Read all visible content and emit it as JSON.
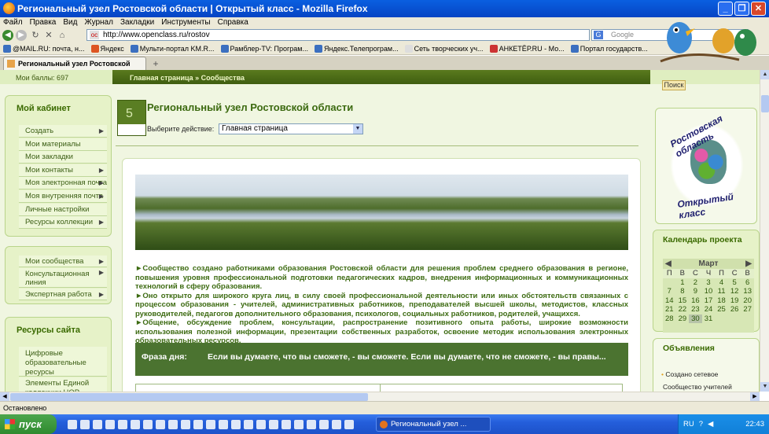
{
  "window": {
    "title": "Региональный узел Ростовской области | Открытый класс - Mozilla Firefox",
    "min": "_",
    "max": "❐",
    "close": "✕"
  },
  "menubar": [
    "Файл",
    "Правка",
    "Вид",
    "Журнал",
    "Закладки",
    "Инструменты",
    "Справка"
  ],
  "nav": {
    "url": "http://www.openclass.ru/rostov",
    "search_placeholder": "Google"
  },
  "bookmarks": [
    "@MAIL.RU: почта, н...",
    "Яндекс",
    "Мульти-портал KM.R...",
    "Рамблер-TV: Програм...",
    "Яндекс.Телепрограм...",
    "Сеть творческих уч...",
    "АНКЕТЁР.RU - Мо...",
    "Портал государств..."
  ],
  "tab": {
    "title": "Региональный узел Ростовской обл...",
    "plus": "+"
  },
  "site": {
    "points": "Мои баллы: 697",
    "breadcrumb": "Главная страница   »   Сообщества",
    "badge": "5",
    "page_title": "Региональный узел Ростовской области",
    "action_label": "Выберите действие:",
    "action_value": "Главная страница"
  },
  "sidebar": {
    "cabinet_title": "Мой кабинет",
    "cabinet_items": [
      {
        "label": "Создать",
        "arrow": "▶"
      },
      {
        "label": "Мои материалы",
        "arrow": ""
      },
      {
        "label": "Мои закладки",
        "arrow": ""
      },
      {
        "label": "Мои контакты",
        "arrow": "▶"
      },
      {
        "label": "Моя электронная почта",
        "arrow": "▶"
      },
      {
        "label": "Моя внутренняя почта",
        "arrow": "▶"
      },
      {
        "label": "Личные настройки",
        "arrow": ""
      },
      {
        "label": "Ресурсы коллекции",
        "arrow": "▶"
      }
    ],
    "community_items": [
      {
        "label": "Мои сообщества",
        "arrow": "▶"
      },
      {
        "label": "Консультационная линия",
        "arrow": "▶"
      },
      {
        "label": "Экспертная работа",
        "arrow": "▶"
      }
    ],
    "resources_title": "Ресурсы сайта",
    "resources_items": [
      {
        "label": "Цифровые образовательные ресурсы"
      },
      {
        "label": "Элементы Единой коллекции ЦОР"
      }
    ]
  },
  "main": {
    "paragraph1": "►Сообщество создано работниками образования Ростовской области для решения проблем среднего образования в регионе, повышения уровня профессиональной подготовки педагогических кадров, внедрения информационных и коммуникационных технологий в сферу образования.",
    "paragraph2": "►Оно открыто для широкого круга лиц, в силу своей профессиональной деятельности или иных обстоятельств связанных с процессом образования - учителей, административных работников, преподавателей высшей школы, методистов, классных руководителей, педагогов дополнительного образования, психологов, социальных работников, родителей, учащихся.",
    "paragraph3": "►Общение, обсуждение проблем, консультации, распространение позитивного опыта работы, широкие возможности использования полезной информации, презентации собственных разработок, освоение методик использования электронных образовательных ресурсов.",
    "phrase_label": "Фраза дня:",
    "phrase_text": "Если вы думаете, что вы сможете, - вы сможете. Если вы думаете, что не сможете, - вы правы..."
  },
  "right": {
    "search_button": "Поиск",
    "logo_text_top": "Ростовская область",
    "logo_text_bottom": "Открытый класс",
    "calendar_title": "Календарь проекта",
    "calendar_month": "Март",
    "calendar_prev": "◀",
    "calendar_next": "▶",
    "weekdays": [
      "П",
      "В",
      "С",
      "Ч",
      "П",
      "С",
      "В"
    ],
    "days": [
      "",
      "1",
      "2",
      "3",
      "4",
      "5",
      "6",
      "7",
      "8",
      "9",
      "10",
      "11",
      "12",
      "13",
      "14",
      "15",
      "16",
      "17",
      "18",
      "19",
      "20",
      "21",
      "22",
      "23",
      "24",
      "25",
      "26",
      "27",
      "28",
      "29",
      "30",
      "31",
      "",
      "",
      "",
      ""
    ],
    "today": "30",
    "ann_title": "Объявления",
    "ann_item": "Создано сетевое",
    "ann_item2": "Сообщество учителей"
  },
  "status": "Остановлено",
  "taskbar": {
    "start": "пуск",
    "item": "Региональный узел ...",
    "lang": "RU",
    "time": "22:43"
  }
}
